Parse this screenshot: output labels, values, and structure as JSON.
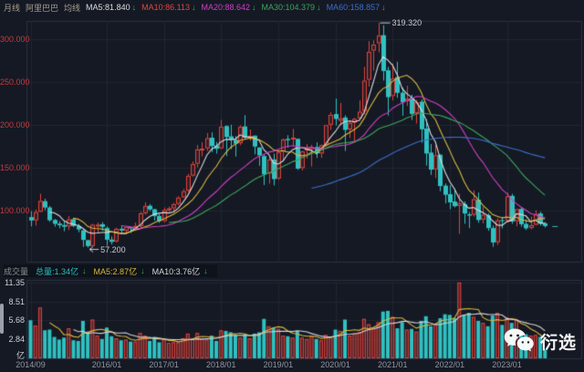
{
  "header": {
    "period_tab": "月线",
    "symbol": "阿里巴巴",
    "ma_caption": "均线",
    "mas": [
      {
        "label": "MA5:81.840",
        "arrow": "↓"
      },
      {
        "label": "MA10:86.113",
        "arrow": "↓"
      },
      {
        "label": "MA20:88.642",
        "arrow": "↓"
      },
      {
        "label": "MA30:104.379",
        "arrow": "↓"
      },
      {
        "label": "MA60:158.857",
        "arrow": "↓"
      }
    ]
  },
  "volume_header": {
    "caption": "成交量",
    "total": "总量:1.34亿",
    "total_arrow": "↓",
    "ma5": "MA5:2.87亿",
    "ma5_arrow": "↓",
    "ma10": "MA10:3.76亿",
    "ma10_arrow": "↓"
  },
  "watermark": {
    "text": "衍选",
    "icon": "wechat-logo-icon"
  },
  "colors": {
    "background": "#151924",
    "up_candle": "#e0443c",
    "down_candle": "#2fc1c1",
    "price_axis_text": "#c43b3b",
    "time_axis_text": "#8f969f",
    "grid": "#20252f",
    "border": "#2a3040",
    "ma_lines": {
      "ma5": "#dcdcde",
      "ma10": "#d9b93e",
      "ma20": "#cf3fc4",
      "ma30": "#3da45a",
      "ma60": "#3b6fc9"
    },
    "volume_ma_lines": {
      "ma5": "#d9b93e",
      "ma10": "#d3d5d9"
    },
    "arrow_green": "#29b94d"
  },
  "chart_data": {
    "type": "candlestick-with-volume",
    "title": "阿里巴巴 月线 (monthly K-line with volume)",
    "price_axis": [
      {
        "label": "300.000",
        "value": 300
      },
      {
        "label": "250.000",
        "value": 250
      },
      {
        "label": "200.000",
        "value": 200
      },
      {
        "label": "150.000",
        "value": 150
      },
      {
        "label": "100.000",
        "value": 100
      }
    ],
    "volume_axis": [
      {
        "label": "11.35",
        "value": 11.35
      },
      {
        "label": "8.51",
        "value": 8.51
      },
      {
        "label": "5.68",
        "value": 5.68
      },
      {
        "label": "2.84",
        "value": 2.84
      }
    ],
    "volume_unit": "亿",
    "x_axis": [
      {
        "label": "2014/09",
        "m": 0
      },
      {
        "label": "2016/01",
        "m": 16
      },
      {
        "label": "2017/01",
        "m": 28
      },
      {
        "label": "2018/01",
        "m": 40
      },
      {
        "label": "2019/01",
        "m": 52
      },
      {
        "label": "2020/01",
        "m": 64
      },
      {
        "label": "2021/01",
        "m": 76
      },
      {
        "label": "2022/01",
        "m": 88
      },
      {
        "label": "2023/01",
        "m": 100
      }
    ],
    "price_mas": [
      {
        "period": 5,
        "color": "#dcdcde"
      },
      {
        "period": 10,
        "color": "#d9b93e"
      },
      {
        "period": 20,
        "color": "#cf3fc4"
      },
      {
        "period": 30,
        "color": "#3da45a"
      },
      {
        "period": 60,
        "color": "#3b6fc9"
      }
    ],
    "volume_mas": [
      {
        "period": 5,
        "color": "#d9b93e"
      },
      {
        "period": 10,
        "color": "#d3d5d9"
      }
    ],
    "annotations": {
      "high_label": "319.320",
      "high_value": 319.32,
      "high_month": 73,
      "low_label": "57.200",
      "low_value": 57.2,
      "low_month": 12
    },
    "fields": [
      "month",
      "open",
      "high",
      "low",
      "close",
      "volume_yi"
    ],
    "months": [
      [
        "2014/09",
        92.7,
        99.7,
        82.0,
        88.85,
        5.7
      ],
      [
        "2014/10",
        89.0,
        101.6,
        82.8,
        98.6,
        4.9
      ],
      [
        "2014/11",
        99.0,
        120.0,
        98.5,
        111.64,
        7.6
      ],
      [
        "2014/12",
        111.3,
        114.2,
        100.9,
        103.94,
        4.2
      ],
      [
        "2015/01",
        104.0,
        105.7,
        87.4,
        89.08,
        4.3
      ],
      [
        "2015/02",
        89.4,
        90.6,
        81.6,
        84.92,
        3.2
      ],
      [
        "2015/03",
        85.2,
        88.0,
        79.8,
        83.24,
        2.8
      ],
      [
        "2015/04",
        83.5,
        87.6,
        76.2,
        81.53,
        3.1
      ],
      [
        "2015/05",
        81.9,
        94.0,
        77.8,
        90.0,
        4.5
      ],
      [
        "2015/06",
        90.3,
        92.0,
        81.0,
        82.27,
        2.7
      ],
      [
        "2015/07",
        82.5,
        84.7,
        75.1,
        78.34,
        2.6
      ],
      [
        "2015/08",
        77.3,
        79.2,
        58.0,
        66.12,
        5.6
      ],
      [
        "2015/09",
        65.8,
        66.4,
        57.2,
        58.94,
        4.0
      ],
      [
        "2015/10",
        59.0,
        85.0,
        58.6,
        83.81,
        5.8
      ],
      [
        "2015/11",
        83.9,
        86.4,
        74.5,
        84.0,
        3.4
      ],
      [
        "2015/12",
        84.5,
        86.8,
        76.7,
        81.27,
        2.9
      ],
      [
        "2016/01",
        80.0,
        81.9,
        59.3,
        66.37,
        4.6
      ],
      [
        "2016/02",
        66.5,
        70.2,
        60.9,
        63.84,
        3.3
      ],
      [
        "2016/03",
        64.3,
        80.3,
        63.3,
        79.03,
        3.0
      ],
      [
        "2016/04",
        79.2,
        82.0,
        73.5,
        77.03,
        2.7
      ],
      [
        "2016/05",
        76.8,
        81.2,
        72.9,
        81.09,
        2.8
      ],
      [
        "2016/06",
        81.0,
        81.9,
        74.2,
        79.53,
        2.5
      ],
      [
        "2016/07",
        79.8,
        86.3,
        77.2,
        82.48,
        2.5
      ],
      [
        "2016/08",
        82.3,
        98.9,
        80.1,
        97.12,
        3.8
      ],
      [
        "2016/09",
        97.3,
        109.9,
        95.4,
        105.79,
        3.4
      ],
      [
        "2016/10",
        106.0,
        108.0,
        99.9,
        101.7,
        2.6
      ],
      [
        "2016/11",
        101.9,
        102.5,
        88.6,
        94.02,
        3.2
      ],
      [
        "2016/12",
        94.2,
        96.4,
        86.0,
        87.81,
        2.4
      ],
      [
        "2017/01",
        88.2,
        104.0,
        86.6,
        101.18,
        2.9
      ],
      [
        "2017/02",
        101.6,
        104.9,
        99.0,
        102.93,
        2.3
      ],
      [
        "2017/03",
        103.0,
        109.3,
        98.8,
        107.83,
        2.4
      ],
      [
        "2017/04",
        108.2,
        117.2,
        106.6,
        115.52,
        2.4
      ],
      [
        "2017/05",
        115.8,
        125.4,
        115.2,
        123.0,
        3.0
      ],
      [
        "2017/06",
        123.5,
        143.3,
        122.0,
        140.9,
        3.7
      ],
      [
        "2017/07",
        141.2,
        157.6,
        140.0,
        154.64,
        3.0
      ],
      [
        "2017/08",
        155.0,
        177.0,
        150.6,
        171.71,
        3.8
      ],
      [
        "2017/09",
        172.4,
        180.0,
        163.7,
        172.69,
        2.9
      ],
      [
        "2017/10",
        173.0,
        190.8,
        170.0,
        184.89,
        2.8
      ],
      [
        "2017/11",
        185.4,
        191.7,
        168.6,
        175.67,
        3.4
      ],
      [
        "2017/12",
        176.2,
        180.4,
        166.8,
        172.43,
        2.6
      ],
      [
        "2018/01",
        173.0,
        206.2,
        172.2,
        198.09,
        4.2
      ],
      [
        "2018/02",
        199.0,
        199.8,
        164.0,
        186.14,
        4.1
      ],
      [
        "2018/03",
        187.0,
        200.5,
        172.0,
        183.54,
        3.9
      ],
      [
        "2018/04",
        183.0,
        187.3,
        163.4,
        178.33,
        3.5
      ],
      [
        "2018/05",
        179.0,
        199.9,
        176.6,
        198.0,
        3.1
      ],
      [
        "2018/06",
        198.5,
        211.7,
        183.7,
        185.53,
        3.6
      ],
      [
        "2018/07",
        186.5,
        195.0,
        181.9,
        187.32,
        3.0
      ],
      [
        "2018/08",
        187.8,
        188.0,
        166.0,
        175.05,
        3.7
      ],
      [
        "2018/09",
        174.0,
        174.3,
        152.5,
        164.76,
        3.9
      ],
      [
        "2018/10",
        164.0,
        165.7,
        130.1,
        142.51,
        5.9
      ],
      [
        "2018/11",
        143.5,
        163.0,
        131.8,
        159.85,
        4.8
      ],
      [
        "2018/12",
        160.0,
        166.7,
        129.77,
        137.07,
        4.6
      ],
      [
        "2019/01",
        137.8,
        171.0,
        136.0,
        168.63,
        4.4
      ],
      [
        "2019/02",
        169.0,
        184.4,
        158.5,
        183.25,
        3.4
      ],
      [
        "2019/03",
        184.0,
        188.4,
        173.7,
        182.45,
        3.3
      ],
      [
        "2019/04",
        183.5,
        195.7,
        175.4,
        185.49,
        3.1
      ],
      [
        "2019/05",
        184.0,
        184.5,
        147.9,
        149.26,
        4.1
      ],
      [
        "2019/06",
        150.0,
        170.0,
        147.3,
        169.45,
        3.1
      ],
      [
        "2019/07",
        170.5,
        178.0,
        161.2,
        173.3,
        2.9
      ],
      [
        "2019/08",
        172.0,
        177.0,
        151.8,
        174.6,
        3.3
      ],
      [
        "2019/09",
        174.5,
        180.0,
        161.7,
        167.25,
        2.9
      ],
      [
        "2019/10",
        167.0,
        177.5,
        161.9,
        176.67,
        2.7
      ],
      [
        "2019/11",
        177.0,
        200.0,
        175.5,
        200.0,
        3.5
      ],
      [
        "2019/12",
        200.5,
        215.1,
        194.5,
        212.1,
        3.2
      ],
      [
        "2020/01",
        213.0,
        231.1,
        199.7,
        207.27,
        4.3
      ],
      [
        "2020/02",
        205.0,
        226.0,
        199.8,
        208.02,
        4.1
      ],
      [
        "2020/03",
        209.0,
        211.5,
        169.9,
        194.48,
        5.8
      ],
      [
        "2020/04",
        195.0,
        206.0,
        185.0,
        202.67,
        3.4
      ],
      [
        "2020/05",
        203.0,
        208.5,
        181.6,
        207.38,
        3.7
      ],
      [
        "2020/06",
        208.0,
        229.0,
        205.5,
        215.7,
        3.9
      ],
      [
        "2020/07",
        216.5,
        268.0,
        213.0,
        251.96,
        5.9
      ],
      [
        "2020/08",
        253.0,
        298.0,
        245.0,
        285.57,
        5.1
      ],
      [
        "2020/09",
        287.0,
        299.0,
        263.6,
        294.01,
        4.6
      ],
      [
        "2020/10",
        295.5,
        319.32,
        285.0,
        304.71,
        5.4
      ],
      [
        "2020/11",
        305.0,
        316.7,
        252.0,
        263.19,
        7.0
      ],
      [
        "2020/12",
        264.0,
        268.0,
        211.2,
        232.73,
        7.1
      ],
      [
        "2021/01",
        234.0,
        272.0,
        229.0,
        254.5,
        6.2
      ],
      [
        "2021/02",
        256.0,
        274.0,
        232.0,
        237.76,
        4.5
      ],
      [
        "2021/03",
        238.0,
        244.0,
        211.0,
        226.73,
        5.4
      ],
      [
        "2021/04",
        228.0,
        246.0,
        222.5,
        231.05,
        4.3
      ],
      [
        "2021/05",
        232.0,
        235.5,
        206.0,
        213.06,
        4.4
      ],
      [
        "2021/06",
        214.0,
        229.5,
        202.0,
        226.78,
        4.0
      ],
      [
        "2021/07",
        227.5,
        230.0,
        179.5,
        195.19,
        5.6
      ],
      [
        "2021/08",
        196.0,
        207.0,
        152.8,
        166.99,
        6.3
      ],
      [
        "2021/09",
        168.0,
        178.0,
        142.0,
        148.18,
        4.8
      ],
      [
        "2021/10",
        148.5,
        177.0,
        138.4,
        164.85,
        5.1
      ],
      [
        "2021/11",
        165.5,
        166.0,
        123.0,
        128.97,
        6.0
      ],
      [
        "2021/12",
        129.5,
        132.0,
        108.7,
        118.79,
        6.6
      ],
      [
        "2022/01",
        119.5,
        130.0,
        102.0,
        109.9,
        6.5
      ],
      [
        "2022/02",
        111.0,
        126.0,
        104.0,
        105.5,
        6.0
      ],
      [
        "2022/03",
        105.8,
        120.0,
        73.28,
        108.93,
        11.35
      ],
      [
        "2022/04",
        108.0,
        111.0,
        85.0,
        96.98,
        6.5
      ],
      [
        "2022/05",
        96.0,
        98.5,
        80.0,
        94.48,
        6.8
      ],
      [
        "2022/06",
        95.5,
        124.0,
        93.5,
        113.66,
        6.2
      ],
      [
        "2022/07",
        113.0,
        121.5,
        86.2,
        89.37,
        5.6
      ],
      [
        "2022/08",
        89.9,
        105.0,
        85.5,
        95.51,
        5.3
      ],
      [
        "2022/09",
        95.0,
        97.0,
        76.8,
        79.94,
        4.8
      ],
      [
        "2022/10",
        80.0,
        83.0,
        58.01,
        63.15,
        6.4
      ],
      [
        "2022/11",
        63.5,
        91.5,
        60.2,
        89.0,
        6.8
      ],
      [
        "2022/12",
        89.3,
        93.0,
        79.5,
        88.09,
        5.0
      ],
      [
        "2023/01",
        88.5,
        121.3,
        87.0,
        117.01,
        6.1
      ],
      [
        "2023/02",
        117.5,
        120.0,
        85.0,
        87.69,
        5.3
      ],
      [
        "2023/03",
        88.0,
        102.5,
        82.0,
        102.0,
        5.8
      ],
      [
        "2023/04",
        102.3,
        104.0,
        81.5,
        84.47,
        3.9
      ],
      [
        "2023/05",
        84.8,
        90.0,
        77.8,
        79.68,
        3.6
      ],
      [
        "2023/06",
        80.0,
        93.3,
        78.5,
        83.34,
        3.4
      ],
      [
        "2023/07",
        83.8,
        100.5,
        83.0,
        96.5,
        3.5
      ],
      [
        "2023/08",
        97.0,
        99.0,
        82.9,
        85.0,
        3.2
      ],
      [
        "2023/09",
        85.5,
        87.0,
        80.5,
        82.3,
        1.34
      ]
    ]
  }
}
